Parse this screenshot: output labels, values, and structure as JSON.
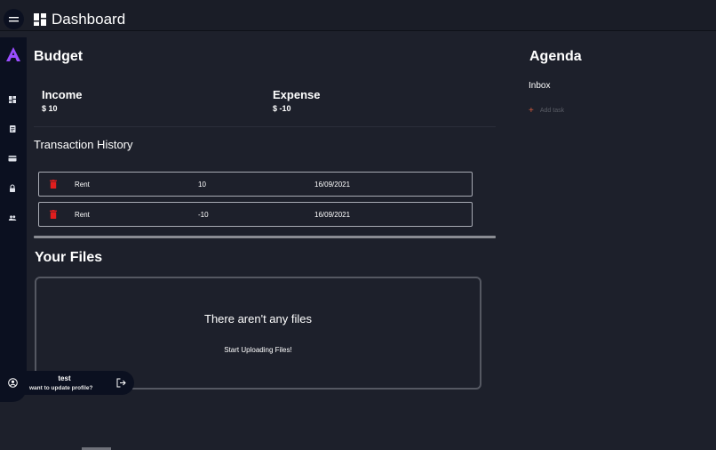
{
  "header": {
    "title": "Dashboard"
  },
  "sidebar": {
    "items": [
      {
        "icon": "dashboard-icon"
      },
      {
        "icon": "notes-icon"
      },
      {
        "icon": "card-icon"
      },
      {
        "icon": "lock-icon"
      },
      {
        "icon": "people-icon"
      }
    ]
  },
  "budget": {
    "title": "Budget",
    "income_label": "Income",
    "income_value": "$ 10",
    "expense_label": "Expense",
    "expense_value": "$ -10"
  },
  "transactions": {
    "title": "Transaction History",
    "rows": [
      {
        "name": "Rent",
        "amount": "10",
        "date": "16/09/2021"
      },
      {
        "name": "Rent",
        "amount": "-10",
        "date": "16/09/2021"
      }
    ]
  },
  "files": {
    "title": "Your Files",
    "empty_text": "There aren't any files",
    "upload_text": "Start Uploading Files!"
  },
  "agenda": {
    "title": "Agenda",
    "inbox_label": "Inbox",
    "add_task_label": "Add task"
  },
  "user": {
    "name": "test",
    "subtitle": "want to update profile?"
  },
  "colors": {
    "background": "#1d202b",
    "sidebar": "#0b1020",
    "logo": "#9b4dff",
    "trash": "#e01e1e",
    "add_task_plus": "#d25a3c"
  }
}
